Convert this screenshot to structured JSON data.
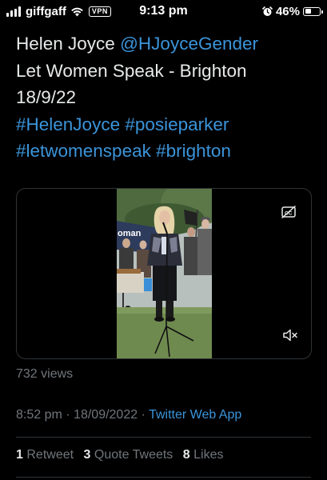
{
  "status_bar": {
    "carrier": "giffgaff",
    "vpn_label": "VPN",
    "time": "9:13 pm",
    "battery_percent": "46%",
    "battery_level": 0.46,
    "signal_bars": 4,
    "icons": [
      "signal-icon",
      "wifi-icon",
      "alarm-icon",
      "battery-icon"
    ]
  },
  "tweet": {
    "author_name": "Helen Joyce",
    "author_handle": "@HJoyceGender",
    "line2": "Let Women Speak - Brighton",
    "line3": "18/9/22",
    "hashtags_line1": [
      "#HelenJoyce",
      "#posieparker"
    ],
    "hashtags_line2": [
      "#letwomenspeak",
      "#brighton"
    ]
  },
  "video": {
    "banner_text": "oman",
    "icons": [
      "captions-off-icon",
      "mute-icon"
    ]
  },
  "meta": {
    "views": "732 views",
    "time": "8:52 pm",
    "date": "18/09/2022",
    "separator": "·",
    "source": "Twitter Web App"
  },
  "stats": {
    "retweets_count": "1",
    "retweets_label": "Retweet",
    "quotes_count": "3",
    "quotes_label": "Quote Tweets",
    "likes_count": "8",
    "likes_label": "Likes"
  },
  "colors": {
    "background": "#000000",
    "text": "#e7e9ea",
    "link": "#3b94d9",
    "secondary": "#71767b",
    "divider": "#2f3336"
  }
}
